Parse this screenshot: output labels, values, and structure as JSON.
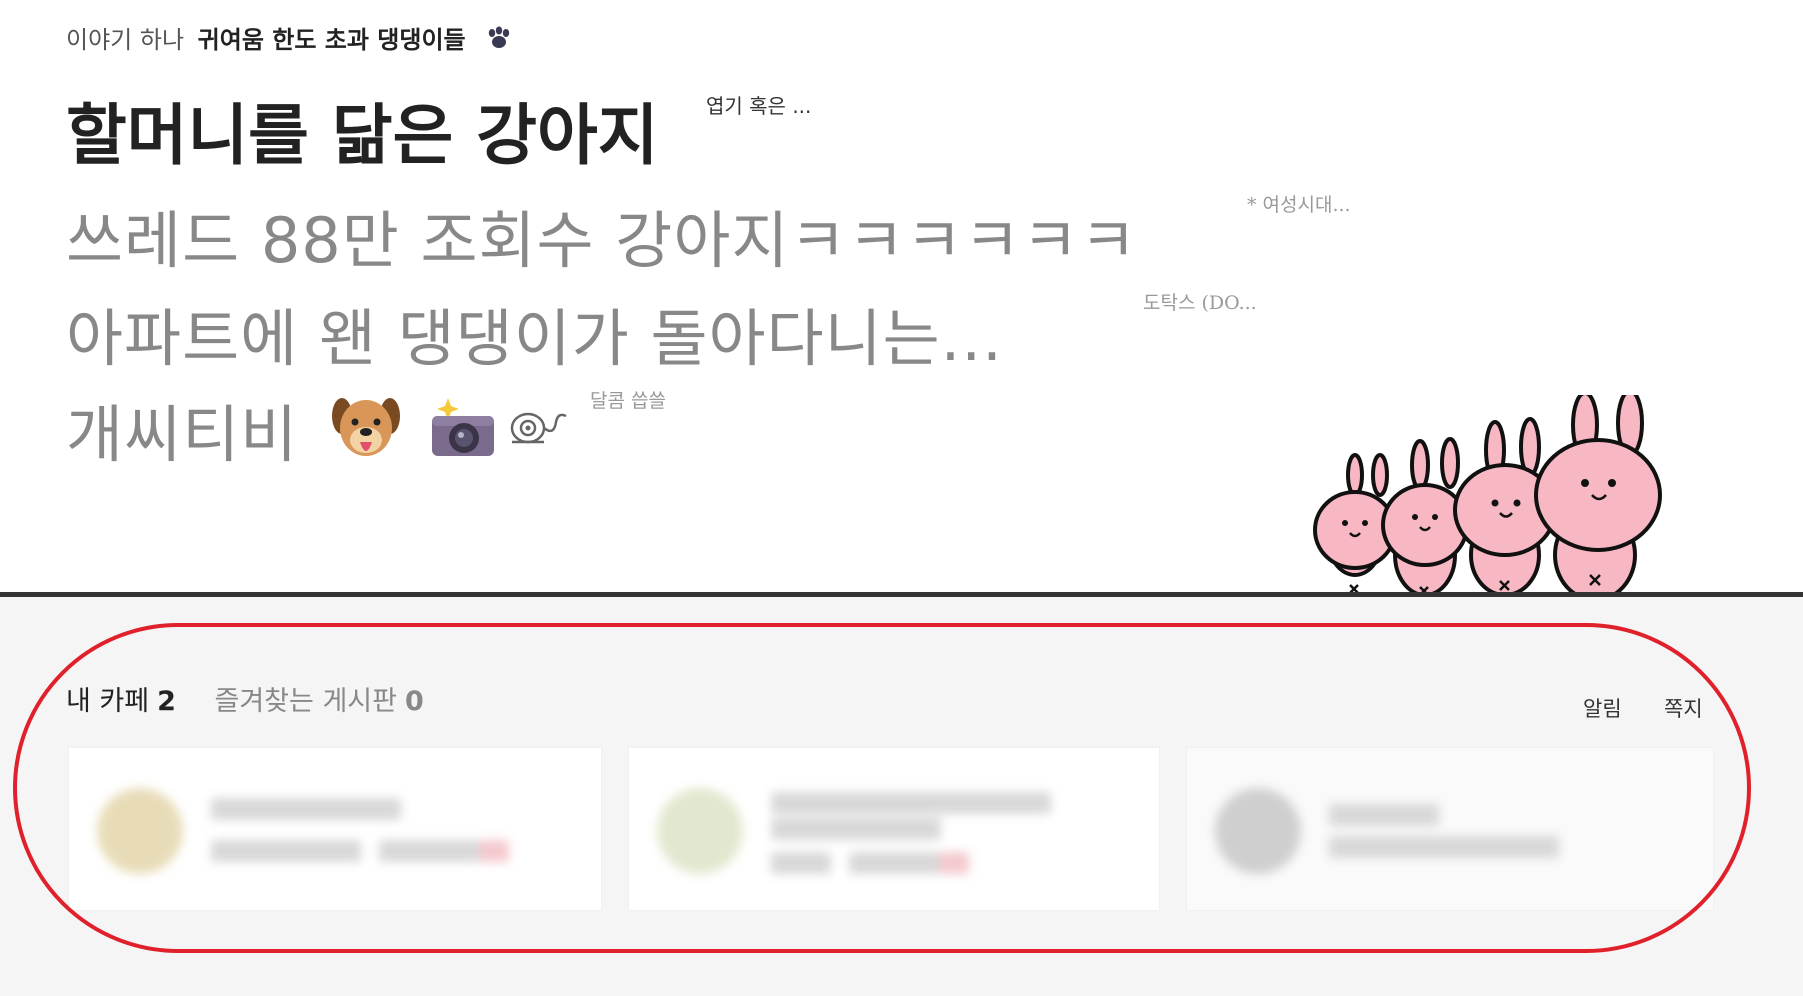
{
  "story": {
    "series_prefix": "이야기 하나",
    "series_title": "귀여움 한도 초과 댕댕이들",
    "series_icon": "paw-icon",
    "headline": "할머니를 닮은 강아지",
    "headline_source": "엽기 혹은 ...",
    "items": [
      {
        "title": "쓰레드 88만 조회수 강아지ㅋㅋㅋㅋㅋㅋ",
        "source": "* 여성시대..."
      },
      {
        "title": "아파트에 왠 댕댕이가 돌아다니는...",
        "source": "도탁스 (DO..."
      },
      {
        "title": "개씨티비",
        "source": "달콤 씁쓸",
        "icons": [
          "dog-face-icon",
          "camera-flash-icon",
          "cctv-icon"
        ]
      }
    ]
  },
  "cafe": {
    "my_cafe_label": "내 카페",
    "my_cafe_count": "2",
    "fav_board_label": "즐겨찾는 게시판",
    "fav_board_count": "0",
    "alarm_label": "알림",
    "message_label": "쪽지"
  },
  "colors": {
    "highlight": "#e0202a",
    "bunny": "#f7b8c4",
    "divider": "#333333"
  }
}
